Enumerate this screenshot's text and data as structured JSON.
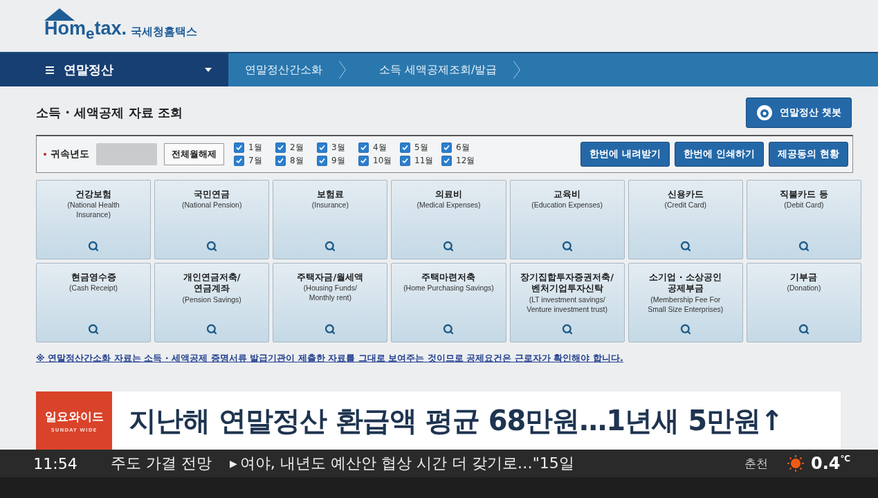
{
  "site": {
    "logo": "Hom$_{e}$tax.",
    "logo_sub": "국세청홈택스"
  },
  "nav": {
    "menu": "연말정산",
    "crumbs": [
      "연말정산간소화",
      "소득 세액공제조회/발급"
    ]
  },
  "page_title": "소득 · 세액공제 자료 조회",
  "chatbot": "연말정산 챗봇",
  "filter": {
    "label": "귀속년도",
    "uncheck_all": "전체월해제",
    "months": [
      {
        "label": "1월",
        "checked": true
      },
      {
        "label": "2월",
        "checked": true
      },
      {
        "label": "3월",
        "checked": true
      },
      {
        "label": "4월",
        "checked": true
      },
      {
        "label": "5월",
        "checked": true
      },
      {
        "label": "6월",
        "checked": true
      },
      {
        "label": "7월",
        "checked": true
      },
      {
        "label": "8월",
        "checked": true
      },
      {
        "label": "9월",
        "checked": true
      },
      {
        "label": "10월",
        "checked": true
      },
      {
        "label": "11월",
        "checked": true
      },
      {
        "label": "12월",
        "checked": true
      }
    ],
    "actions": [
      "한번에 내려받기",
      "한번에 인쇄하기",
      "제공동의 현황"
    ]
  },
  "tiles": [
    {
      "title": "건강보험",
      "subtitle": "(National Health\nInsurance)"
    },
    {
      "title": "국민연금",
      "subtitle": "(National Pension)"
    },
    {
      "title": "보험료",
      "subtitle": "(Insurance)"
    },
    {
      "title": "의료비",
      "subtitle": "(Medical Expenses)"
    },
    {
      "title": "교육비",
      "subtitle": "(Education Expenses)"
    },
    {
      "title": "신용카드",
      "subtitle": "(Credit Card)"
    },
    {
      "title": "직불카드 등",
      "subtitle": "(Debit Card)"
    },
    {
      "title": "현금영수증",
      "subtitle": "(Cash Receipt)"
    },
    {
      "title": "개인연금저축/\n연금계좌",
      "subtitle": "(Pension Savings)"
    },
    {
      "title": "주택자금/월세액",
      "subtitle": "(Housing Funds/\nMonthly rent)"
    },
    {
      "title": "주택마련저축",
      "subtitle": "(Home Purchasing Savings)"
    },
    {
      "title": "장기집합투자증권저축/\n벤처기업투자신탁",
      "subtitle": "(LT investment savings/\nVenture investment trust)"
    },
    {
      "title": "소기업 · 소상공인\n공제부금",
      "subtitle": "(Membership Fee For\nSmall Size Enterprises)"
    },
    {
      "title": "기부금",
      "subtitle": "(Donation)"
    }
  ],
  "notice": "※ 연말정산간소화 자료는 소득 · 세액공제 증명서류 발급기관이 제출한 자료를 그대로 보여주는 것이므로 공제요건은 근로자가 확인해야 합니다.",
  "caption": {
    "program": "일요와이드",
    "program_en": "SUNDAY WIDE",
    "headline": "지난해 연말정산 환급액 평균 68만원…1년새 5만원↑"
  },
  "ticker": {
    "time": "11:54",
    "items": [
      {
        "text": "주도 가결 전망",
        "marker": false
      },
      {
        "text": "여야, 내년도 예산안 협상 시간 더 갖기로…\"15일",
        "marker": true
      }
    ],
    "marker_glyph": "▶"
  },
  "weather": {
    "city": "춘천",
    "temp": "0.4",
    "unit": "℃"
  }
}
